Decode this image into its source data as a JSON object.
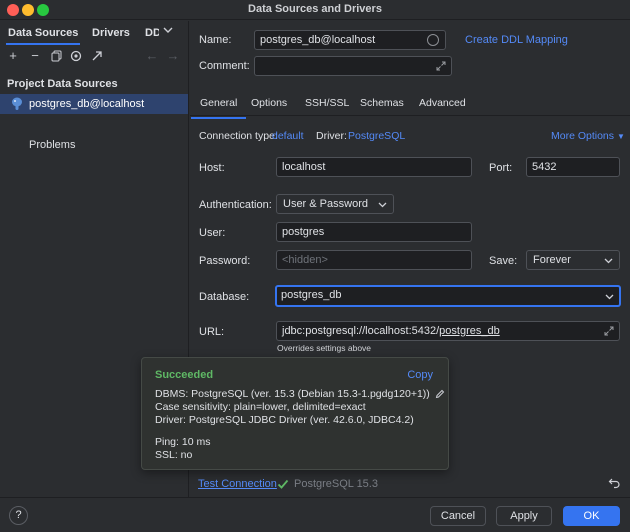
{
  "window": {
    "title": "Data Sources and Drivers"
  },
  "left": {
    "tabs": [
      "Data Sources",
      "Drivers",
      "DD"
    ],
    "section_title": "Project Data Sources",
    "selected_item": "postgres_db@localhost",
    "problems_label": "Problems"
  },
  "header": {
    "name_label": "Name:",
    "name_value": "postgres_db@localhost",
    "create_ddl_link": "Create DDL Mapping",
    "comment_label": "Comment:"
  },
  "tabs": [
    "General",
    "Options",
    "SSH/SSL",
    "Schemas",
    "Advanced"
  ],
  "connection": {
    "type_label": "Connection type:",
    "type_value": "default",
    "driver_label": "Driver:",
    "driver_value": "PostgreSQL",
    "more_options": "More Options"
  },
  "form": {
    "host_label": "Host:",
    "host_value": "localhost",
    "port_label": "Port:",
    "port_value": "5432",
    "auth_label": "Authentication:",
    "auth_value": "User & Password",
    "user_label": "User:",
    "user_value": "postgres",
    "password_label": "Password:",
    "password_placeholder": "<hidden>",
    "save_label": "Save:",
    "save_value": "Forever",
    "database_label": "Database:",
    "database_value": "postgres_db",
    "url_label": "URL:",
    "url_prefix": "jdbc:postgresql://localhost:5432/",
    "url_db": "postgres_db",
    "url_hint": "Overrides settings above"
  },
  "popup": {
    "title": "Succeeded",
    "copy": "Copy",
    "lines": [
      "DBMS: PostgreSQL (ver. 15.3 (Debian 15.3-1.pgdg120+1))",
      "Case sensitivity: plain=lower, delimited=exact",
      "Driver: PostgreSQL JDBC Driver (ver. 42.6.0, JDBC4.2)",
      "Ping: 10 ms",
      "SSL: no"
    ]
  },
  "test": {
    "link": "Test Connection",
    "result": "PostgreSQL 15.3"
  },
  "footer": {
    "help": "?",
    "cancel": "Cancel",
    "apply": "Apply",
    "ok": "OK"
  },
  "colors": {
    "accent": "#3574f0",
    "success": "#5fb865",
    "link": "#548af7",
    "selection": "#2e436e"
  }
}
